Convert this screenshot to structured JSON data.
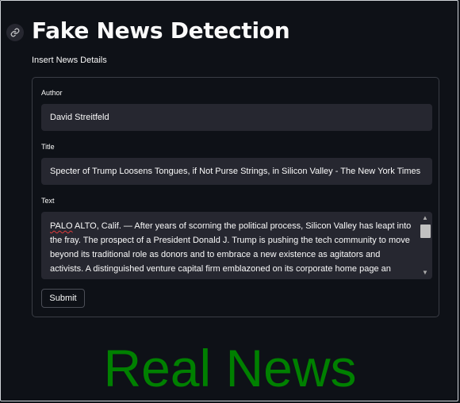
{
  "header": {
    "title": "Fake News Detection",
    "subtitle": "Insert News Details"
  },
  "form": {
    "author_label": "Author",
    "author_value": "David Streitfeld",
    "title_label": "Title",
    "title_value": "Specter of Trump Loosens Tongues, if Not Purse Strings, in Silicon Valley - The New York Times",
    "text_label": "Text",
    "text_first_word": "PALO",
    "text_rest": " ALTO, Calif.  —  After years of scorning the political process, Silicon Valley has leapt into the fray. The prospect of a President Donald J. Trump is pushing the tech community to move beyond its traditional role as donors and to embrace a new existence as agitators and activists. A distinguished venture capital firm emblazoned on its corporate home page an",
    "submit_label": "Submit"
  },
  "result": {
    "label": "Real News",
    "color": "#008000"
  },
  "icons": [
    "link-icon",
    "scroll-up-icon",
    "scroll-down-icon"
  ]
}
